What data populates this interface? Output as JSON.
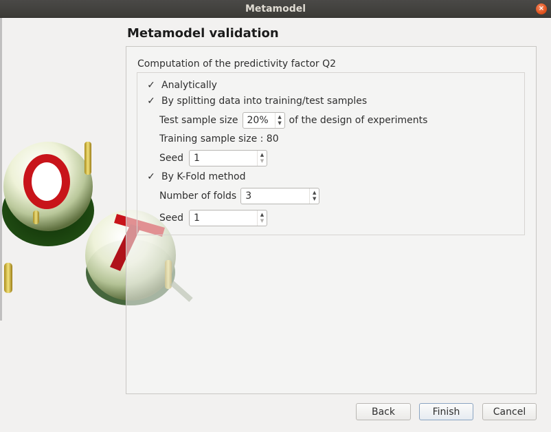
{
  "window": {
    "title": "Metamodel",
    "close_glyph": "×"
  },
  "page": {
    "title": "Metamodel validation"
  },
  "section": {
    "title": "Computation of the predictivity factor Q2"
  },
  "options": {
    "analytically": {
      "label": "Analytically",
      "checked": true
    },
    "splitting": {
      "label": "By splitting data into training/test samples",
      "checked": true,
      "test_size_label": "Test sample size",
      "test_size_value": "20%",
      "test_size_suffix": "of the design of experiments",
      "training_size_text": "Training sample size : 80",
      "seed_label": "Seed",
      "seed_value": "1"
    },
    "kfold": {
      "label": "By K-Fold method",
      "checked": true,
      "folds_label": "Number of folds",
      "folds_value": "3",
      "seed_label": "Seed",
      "seed_value": "1"
    }
  },
  "icons": {
    "check": "✓",
    "spin_up": "▲",
    "spin_down": "▼"
  },
  "buttons": {
    "back": "Back",
    "finish": "Finish",
    "cancel": "Cancel"
  }
}
